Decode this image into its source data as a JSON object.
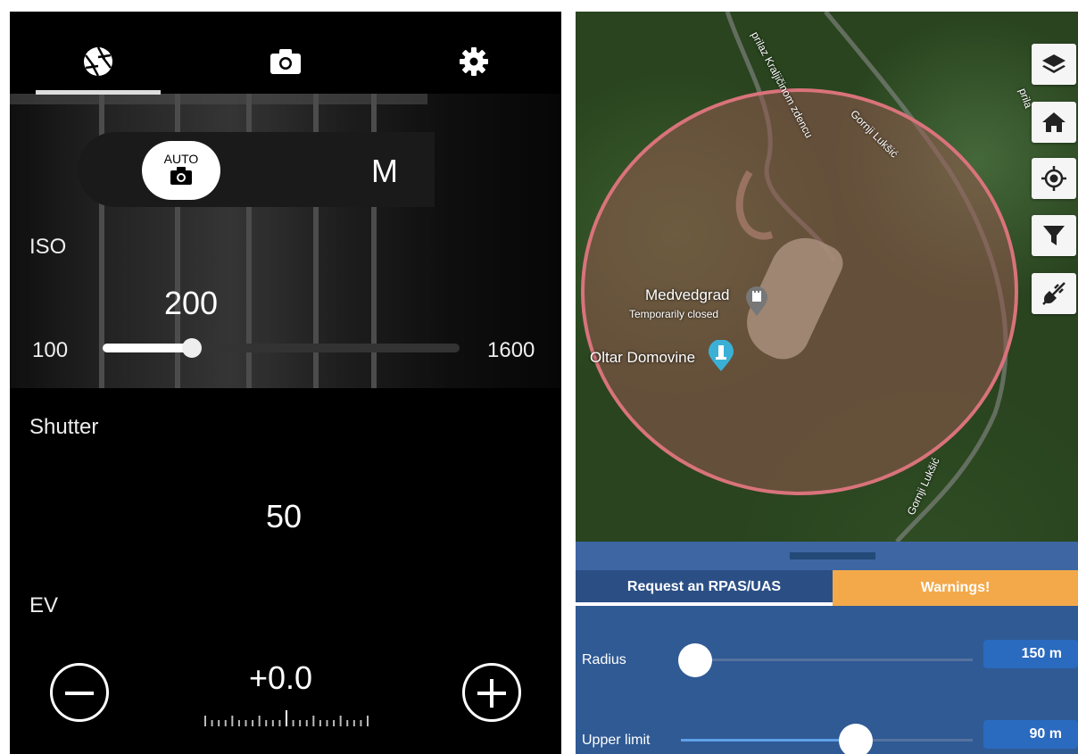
{
  "camera": {
    "tabs": [
      {
        "icon": "aperture-icon",
        "active": true
      },
      {
        "icon": "camera-icon"
      },
      {
        "icon": "gear-icon"
      }
    ],
    "mode": {
      "auto_label": "AUTO",
      "manual_label": "M",
      "selected": "AUTO"
    },
    "iso": {
      "label": "ISO",
      "value": "200",
      "min": "100",
      "max": "1600",
      "level": 0.25
    },
    "shutter": {
      "label": "Shutter",
      "value": "50"
    },
    "ev": {
      "label": "EV",
      "value": "+0.0",
      "minus_icon": "minus-circle-icon",
      "plus_icon": "plus-circle-icon"
    }
  },
  "map": {
    "roads": [
      "prilaz Kraljičinom zdencu",
      "Gornji Lukšić",
      "Gornji Lukšić",
      "prila"
    ],
    "poi": [
      {
        "name": "Medvedgrad",
        "subtitle": "Temporarily closed",
        "icon": "castle-pin-icon"
      },
      {
        "name": "Oltar Domovine",
        "icon": "monument-pin-icon"
      }
    ],
    "buttons": [
      "layers-icon",
      "home-icon",
      "locate-icon",
      "filter-icon",
      "plug-icon"
    ],
    "zone_color": "#d9737b",
    "sheet": {
      "tabs": {
        "request": "Request an RPAS/UAS",
        "warnings": "Warnings!"
      },
      "radius": {
        "label": "Radius",
        "value": "150 m",
        "level": 0.05
      },
      "upper_limit": {
        "label": "Upper limit",
        "value": "90 m",
        "level": 0.6
      }
    }
  }
}
